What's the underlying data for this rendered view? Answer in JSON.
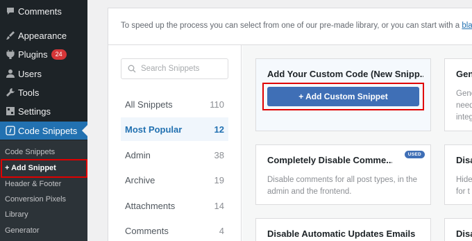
{
  "sidebar": {
    "items": [
      {
        "label": "Comments",
        "icon": "comment-icon"
      },
      {
        "label": "Appearance",
        "icon": "paintbrush-icon"
      },
      {
        "label": "Plugins",
        "icon": "plug-icon",
        "badge": "24"
      },
      {
        "label": "Users",
        "icon": "user-icon"
      },
      {
        "label": "Tools",
        "icon": "wrench-icon"
      },
      {
        "label": "Settings",
        "icon": "sliders-icon"
      },
      {
        "label": "Code Snippets",
        "icon": "code-icon"
      }
    ],
    "submenu": [
      "Code Snippets",
      "+ Add Snippet",
      "Header & Footer",
      "Conversion Pixels",
      "Library",
      "Generator"
    ]
  },
  "intro": {
    "text": "To speed up the process you can select from one of our pre-made library, or you can start with a ",
    "link": "blank"
  },
  "search": {
    "placeholder": "Search Snippets"
  },
  "categories": [
    {
      "label": "All Snippets",
      "count": "110"
    },
    {
      "label": "Most Popular",
      "count": "12"
    },
    {
      "label": "Admin",
      "count": "38"
    },
    {
      "label": "Archive",
      "count": "19"
    },
    {
      "label": "Attachments",
      "count": "14"
    },
    {
      "label": "Comments",
      "count": "4"
    }
  ],
  "cards": {
    "custom": {
      "title": "Add Your Custom Code (New Snipp...",
      "button": "+ Add Custom Snippet"
    },
    "generator_partial": {
      "title": "Gen",
      "desc": [
        "Gene",
        "need",
        "integ"
      ]
    },
    "disable_comments": {
      "title": "Completely Disable Comme...",
      "badge": "USED",
      "desc": "Disable comments for all post types, in the admin and the frontend."
    },
    "disable_partial": {
      "title": "Disa",
      "desc": [
        "Hide",
        "for t"
      ]
    },
    "disable_updates": {
      "title": "Disable Automatic Updates Emails"
    },
    "disable_partial2": {
      "title": "Disa"
    }
  },
  "colors": {
    "sidebar_bg": "#1d2327",
    "accent": "#2271b1",
    "button": "#3f6fb6",
    "highlight": "#e00000"
  }
}
